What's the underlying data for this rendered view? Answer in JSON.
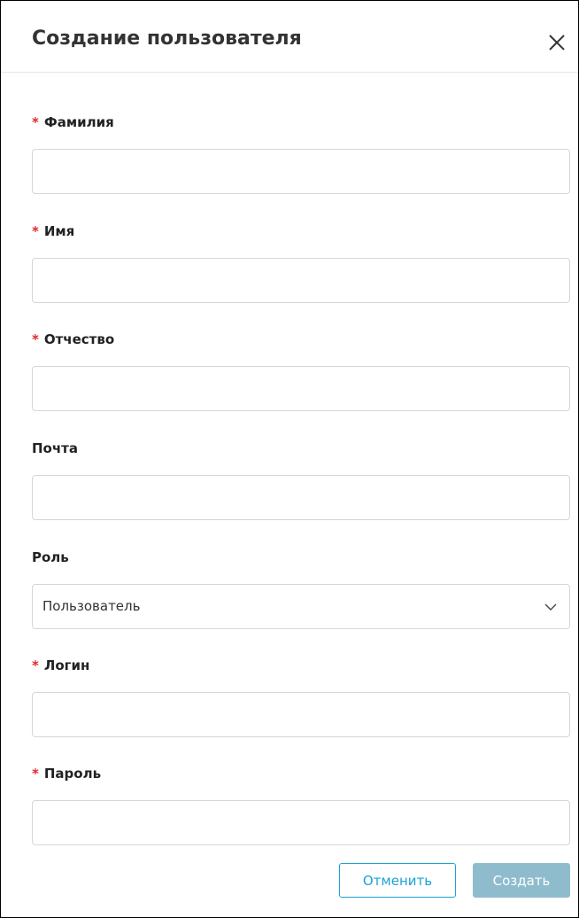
{
  "dialog": {
    "title": "Создание пользователя",
    "close_icon": "close-icon"
  },
  "fields": {
    "last_name": {
      "label": "Фамилия",
      "required": true,
      "value": ""
    },
    "first_name": {
      "label": "Имя",
      "required": true,
      "value": ""
    },
    "patronymic": {
      "label": "Отчество",
      "required": true,
      "value": ""
    },
    "email": {
      "label": "Почта",
      "required": false,
      "value": ""
    },
    "role": {
      "label": "Роль",
      "required": false,
      "value": "Пользователь",
      "icon": "chevron-down-icon"
    },
    "login": {
      "label": "Логин",
      "required": true,
      "value": ""
    },
    "password": {
      "label": "Пароль",
      "required": true,
      "value": ""
    }
  },
  "required_marker": "*",
  "actions": {
    "cancel_label": "Отменить",
    "create_label": "Создать"
  },
  "colors": {
    "required": "#e0292d",
    "cancel_accent": "#1ba3d6",
    "create_disabled": "#8fbccd"
  }
}
